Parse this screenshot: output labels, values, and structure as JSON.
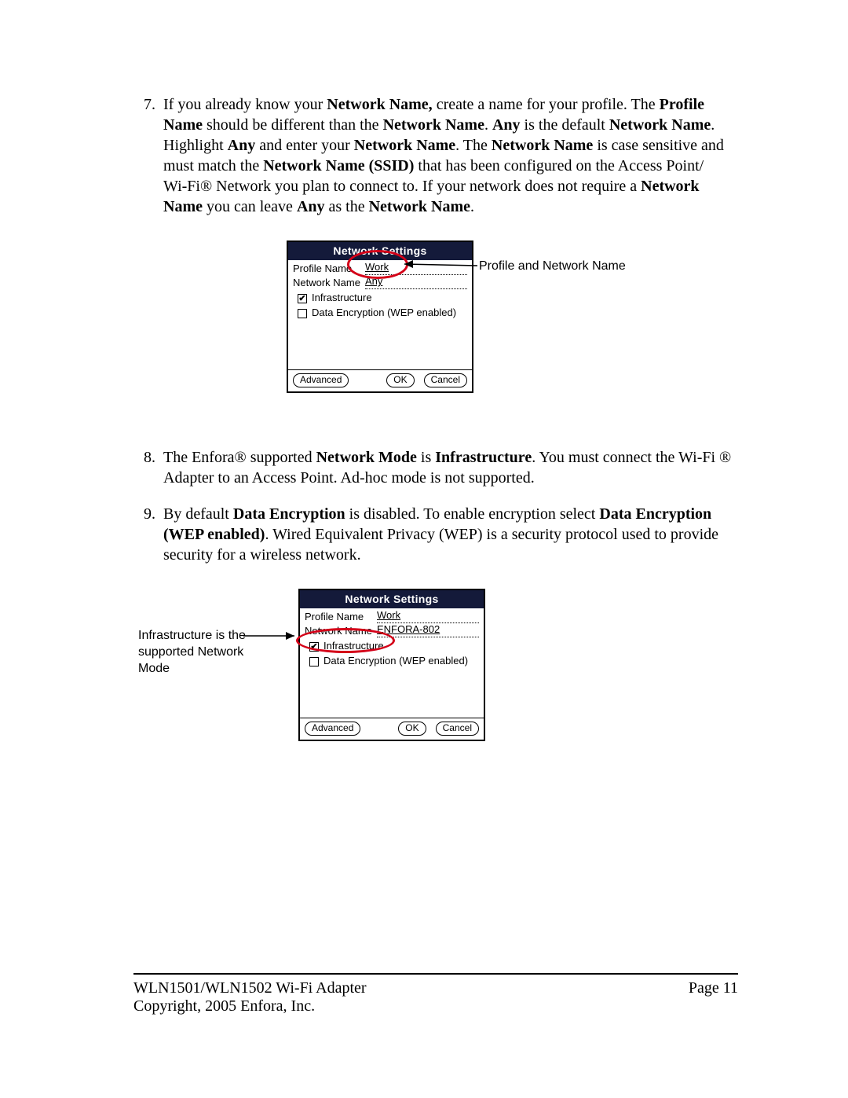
{
  "steps": {
    "s7": {
      "num": "7.",
      "parts": [
        {
          "t": "If you already know your "
        },
        {
          "t": "Network Name,",
          "b": true
        },
        {
          "t": " create a name for your profile. The "
        },
        {
          "t": "Profile Name",
          "b": true
        },
        {
          "t": " should be different than the "
        },
        {
          "t": "Network Name",
          "b": true
        },
        {
          "t": ".  "
        },
        {
          "t": "Any",
          "b": true
        },
        {
          "t": " is the default "
        },
        {
          "t": "Network Name",
          "b": true
        },
        {
          "t": ". Highlight "
        },
        {
          "t": "Any",
          "b": true
        },
        {
          "t": " and enter your "
        },
        {
          "t": "Network Name",
          "b": true
        },
        {
          "t": ".  The "
        },
        {
          "t": "Network Name",
          "b": true
        },
        {
          "t": " is case sensitive and must match the "
        },
        {
          "t": "Network Name (SSID)",
          "b": true
        },
        {
          "t": " that has been configured on the Access Point/ Wi‑Fi® Network you plan to connect to.  If your network does not require a "
        },
        {
          "t": "Network Name",
          "b": true
        },
        {
          "t": " you can leave "
        },
        {
          "t": "Any",
          "b": true
        },
        {
          "t": " as the "
        },
        {
          "t": "Network Name",
          "b": true
        },
        {
          "t": "."
        }
      ]
    },
    "s8": {
      "num": "8.",
      "parts": [
        {
          "t": "The Enfora® supported "
        },
        {
          "t": "Network Mode",
          "b": true
        },
        {
          "t": " is "
        },
        {
          "t": "Infrastructure",
          "b": true
        },
        {
          "t": ".  You must connect the Wi‑Fi ® Adapter to an Access Point.  Ad-hoc mode is not supported."
        }
      ]
    },
    "s9": {
      "num": "9.",
      "parts": [
        {
          "t": "By default "
        },
        {
          "t": "Data Encryption",
          "b": true
        },
        {
          "t": " is disabled.  To enable encryption select "
        },
        {
          "t": "Data Encryption (WEP enabled)",
          "b": true
        },
        {
          "t": ".  Wired Equivalent Privacy (WEP) is a security protocol used to provide security for a wireless network."
        }
      ]
    }
  },
  "fig1": {
    "title": "Network Settings",
    "profile_label": "Profile Name",
    "profile_value": "Work",
    "network_label": "Network Name",
    "network_value": "Any",
    "cb_infrastructure": "Infrastructure",
    "cb_wep": "Data Encryption (WEP enabled)",
    "btn_advanced": "Advanced",
    "btn_ok": "OK",
    "btn_cancel": "Cancel",
    "callout_right": "Profile and Network Name"
  },
  "fig2": {
    "title": "Network Settings",
    "profile_label": "Profile Name",
    "profile_value": "Work",
    "network_label": "Network Name",
    "network_value": "ENFORA-802",
    "cb_infrastructure": "Infrastructure",
    "cb_wep": "Data Encryption (WEP enabled)",
    "btn_advanced": "Advanced",
    "btn_ok": "OK",
    "btn_cancel": "Cancel",
    "callout_left": "Infrastructure is the supported Network Mode"
  },
  "footer": {
    "left_line1": "WLN1501/WLN1502 Wi-Fi Adapter",
    "left_line2": "Copyright, 2005 Enfora, Inc.",
    "right": "Page 11"
  }
}
